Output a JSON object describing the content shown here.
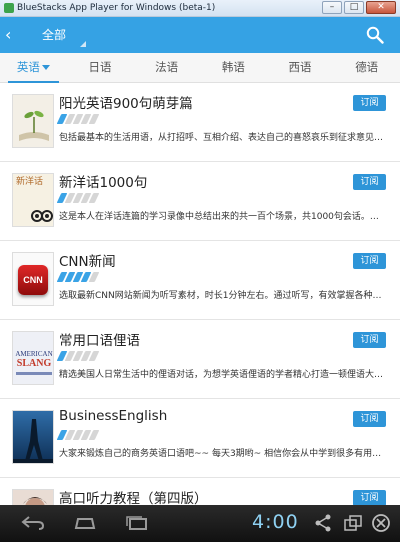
{
  "window": {
    "title": "BlueStacks App Player for Windows (beta-1)",
    "minimize": "–",
    "maximize": "□",
    "close": "✕"
  },
  "header": {
    "back_icon": "‹",
    "title": "全部",
    "search_icon": "search-icon",
    "color": "#35a2e4"
  },
  "tabs": [
    {
      "label": "英语",
      "active": true
    },
    {
      "label": "日语",
      "active": false
    },
    {
      "label": "法语",
      "active": false
    },
    {
      "label": "韩语",
      "active": false
    },
    {
      "label": "西语",
      "active": false
    },
    {
      "label": "德语",
      "active": false
    }
  ],
  "items": [
    {
      "title": "阳光英语900句萌芽篇",
      "rating": 1,
      "desc": "包括最基本的生活用语，从打招呼、互相介绍、表达自己的喜怒哀乐到征求意见…",
      "subscribe": "订阅"
    },
    {
      "title": "新洋话1000句",
      "rating": 1,
      "desc": "这是本人在洋话连篇的学习录像中总结出来的共一百个场景，共1000句会话。…",
      "subscribe": "订阅"
    },
    {
      "title": "CNN新闻",
      "rating": 4,
      "desc": "选取最新CNN网站新闻为听写素材，时长1分钟左右。通过听写，有效掌握各种…",
      "subscribe": "订阅"
    },
    {
      "title": "常用口语俚语",
      "rating": 1,
      "desc": "精选美国人日常生活中的俚语对话，为想学英语俚语的学者精心打造一顿俚语大…",
      "subscribe": "订阅"
    },
    {
      "title": "BusinessEnglish",
      "rating": 1,
      "desc": "大家来锻炼自己的商务英语口语吧~~ 每天3期哟~ 相信你会从中学到很多有用的…",
      "subscribe": "订阅"
    },
    {
      "title": "高口听力教程（第四版）",
      "rating": 1,
      "desc": "",
      "subscribe": "订阅"
    }
  ],
  "thumb_text": {
    "item2": "新洋话",
    "item3": "CNN",
    "item4a": "AMERICAN",
    "item4b": "SLANG"
  },
  "navbar": {
    "clock": "4:00",
    "icons": [
      "back-icon",
      "home-icon",
      "recent-apps-icon",
      "share-icon",
      "window-toggle-icon",
      "close-icon"
    ]
  }
}
